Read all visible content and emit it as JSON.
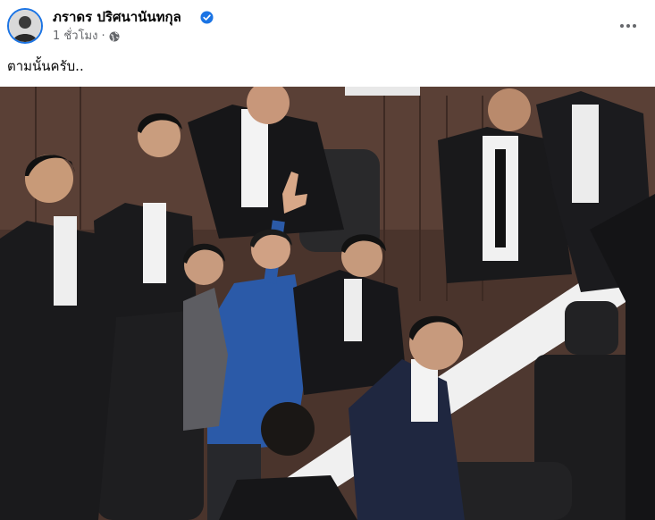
{
  "post": {
    "author_name": "ภราดร ปริศนานันทกุล",
    "time": "1 ชั่วโมง",
    "separator": "·",
    "text": "ตามนั้นครับ..",
    "more_icon": "more-horizontal-icon",
    "privacy_icon": "globe-icon",
    "verified_icon": "verified-badge-icon"
  },
  "colors": {
    "verified": "#1b74e4",
    "secondary_text": "#65676b",
    "primary_text": "#050505"
  }
}
